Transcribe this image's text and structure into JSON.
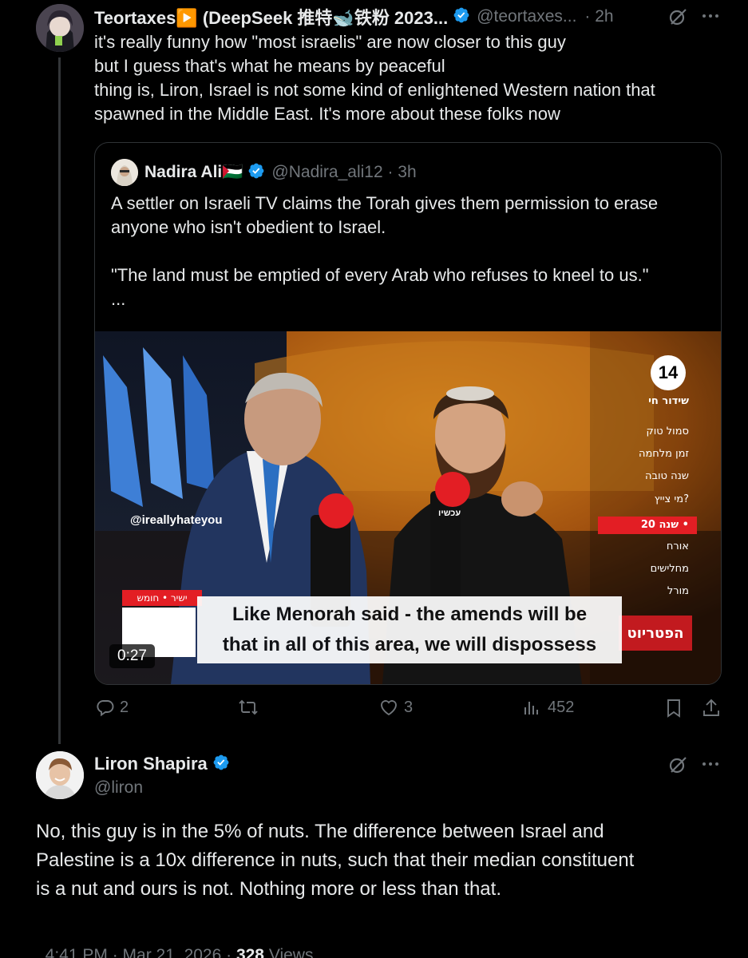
{
  "tweet1": {
    "name": "Teortaxes▶️ (DeepSeek 推特🐋铁粉 2023...",
    "handle": "@teortaxes...",
    "time": "· 2h",
    "lines": [
      "it's really funny how \"most israelis\" are now closer to this guy",
      "but I guess that's what he means by peaceful",
      "thing is, Liron, Israel is not some kind of enlightened Western nation that",
      "spawned in the Middle East. It's more about these folks now"
    ]
  },
  "quote": {
    "name": "Nadira Ali🇵🇸",
    "handle": "@Nadira_ali12 · 3h",
    "lines": [
      "A settler on Israeli TV claims the Torah gives them permission to erase",
      "anyone who isn't obedient to Israel.",
      "",
      "\"The land must be emptied of every Arab who refuses to kneel to us.\"",
      "..."
    ],
    "video": {
      "duration": "0:27",
      "watermark": "@ireallyhateyou",
      "channel_number": "14",
      "live_label": "שידור חי",
      "menu": [
        "סמול טוק",
        "זמן מלחמה",
        "שנה טובה",
        "מי צייץ?",
        "20 שנה •",
        "אורח",
        "מחלישים",
        "מורל"
      ],
      "ticker": "ישיר • חומש",
      "subtitle_line1": "Like Menorah said - the amends will be",
      "subtitle_line2": "that in all of this area, we will dispossess",
      "show_logo": "הפטריוט",
      "mic_label": "עכשיו"
    }
  },
  "actions": {
    "replies": "2",
    "reposts": "",
    "likes": "3",
    "views": "452"
  },
  "tweet2": {
    "name": "Liron Shapira",
    "handle": "@liron",
    "lines": [
      "No, this guy is in the 5% of nuts. The difference between Israel and",
      "Palestine is a 10x difference in nuts, such that their median constituent",
      "is a nut and ours is not. Nothing more or less than that."
    ],
    "time": "4:41 PM · Mar 21, 2026 · ",
    "views_count": "328",
    "views_label": " Views"
  },
  "colors": {
    "verified": "#1d9bf0",
    "muted": "#71767b",
    "border": "#2f3336",
    "channel_red": "#e31e24"
  },
  "icons": [
    "grok-icon",
    "more-icon",
    "reply-icon",
    "repost-icon",
    "like-icon",
    "views-icon",
    "bookmark-icon",
    "share-icon",
    "verified-icon"
  ]
}
